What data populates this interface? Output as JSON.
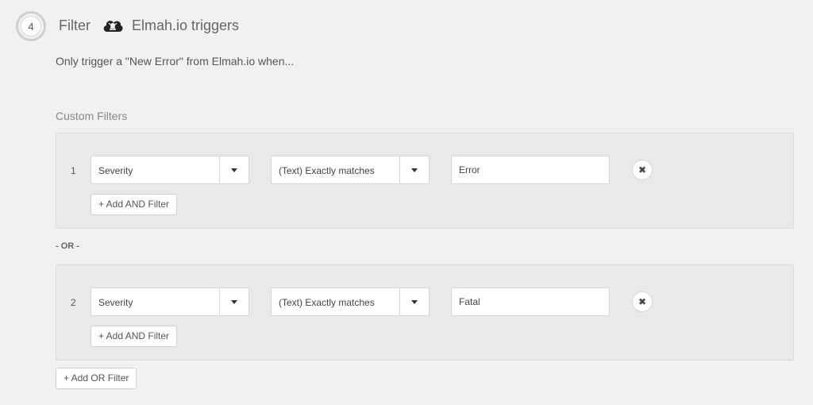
{
  "step": {
    "number": "4",
    "title": "Filter",
    "app_icon": "elmah-cloud-icon",
    "app_name": "Elmah.io triggers"
  },
  "subtitle": "Only trigger a \"New Error\" from Elmah.io when...",
  "custom_filters": {
    "title": "Custom Filters",
    "or_separator": "- OR -",
    "add_or_label": "+ Add OR Filter",
    "groups": [
      {
        "number": "1",
        "field": "Severity",
        "operator": "(Text) Exactly matches",
        "value": "Error",
        "remove_icon": "close-icon",
        "add_and_label": "+ Add AND Filter"
      },
      {
        "number": "2",
        "field": "Severity",
        "operator": "(Text) Exactly matches",
        "value": "Fatal",
        "remove_icon": "close-icon",
        "add_and_label": "+ Add AND Filter"
      }
    ]
  },
  "colors": {
    "background": "#f1f1f1",
    "panel": "#e9e9e9",
    "border": "#d6d6d6",
    "text": "#555555"
  }
}
